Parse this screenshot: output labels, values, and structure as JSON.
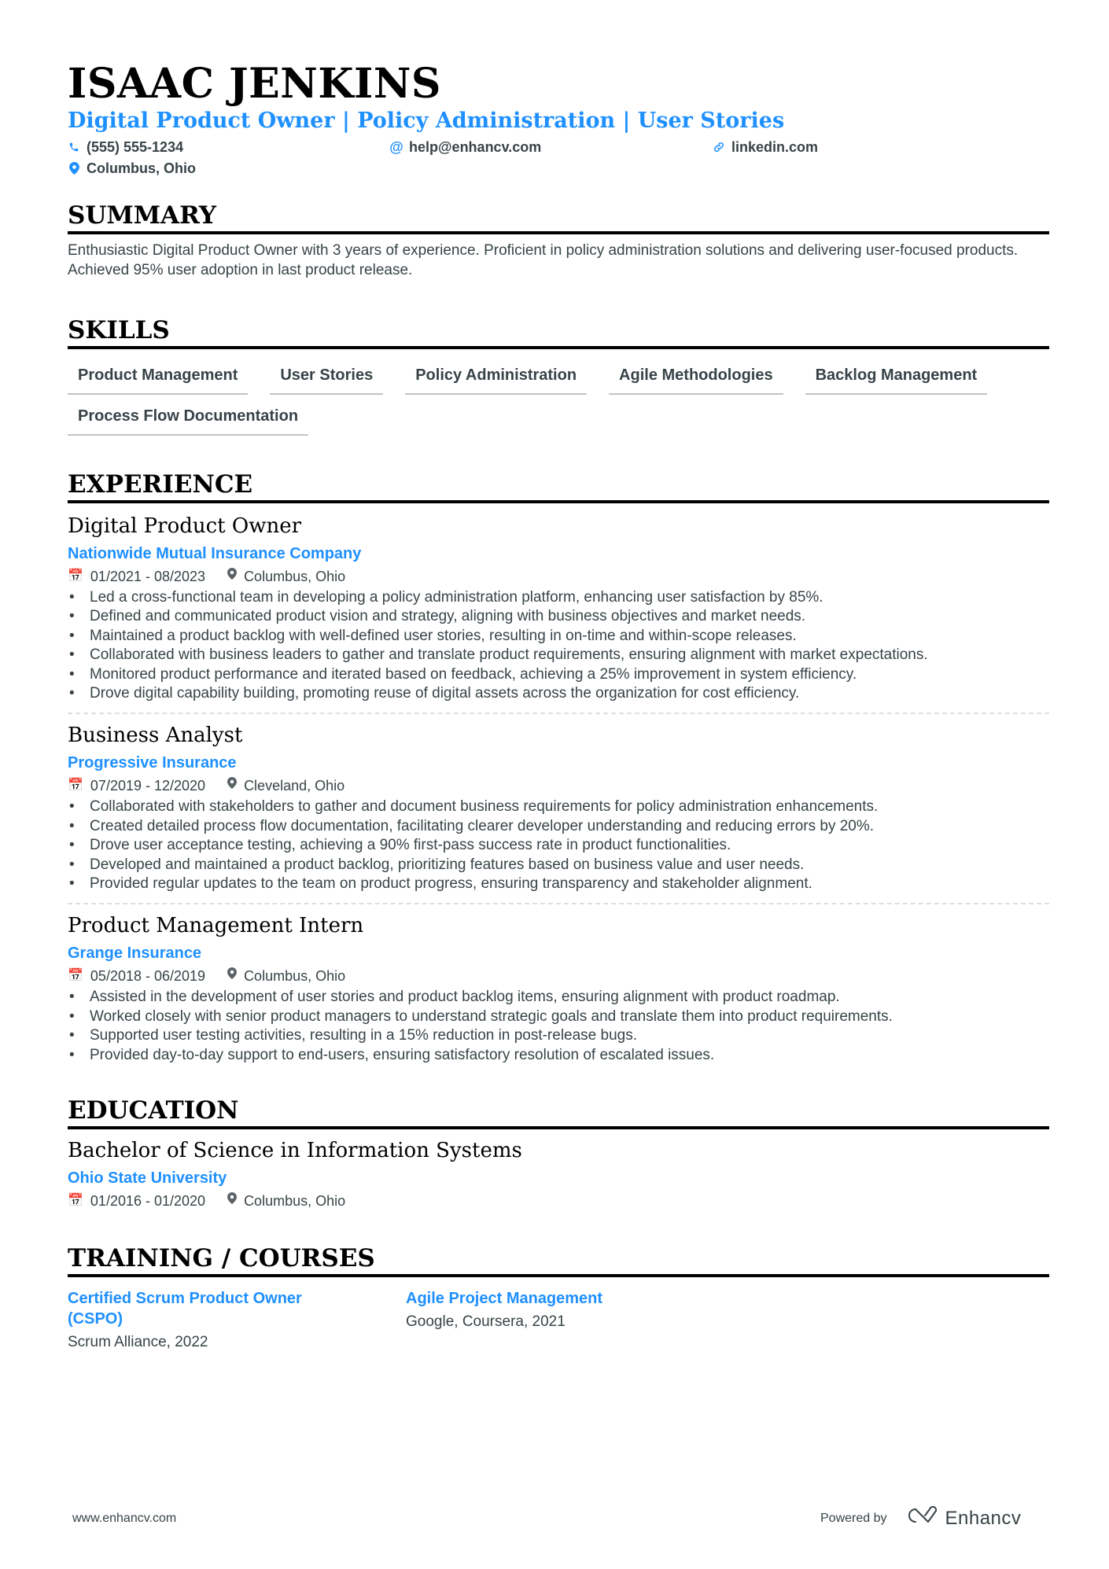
{
  "header": {
    "name": "ISAAC JENKINS",
    "headline": "Digital Product Owner | Policy Administration | User Stories",
    "contacts": {
      "phone": {
        "icon": "phone-icon",
        "value": "(555) 555-1234"
      },
      "email": {
        "icon": "at-icon",
        "value": "help@enhancv.com"
      },
      "website": {
        "icon": "link-icon",
        "value": "linkedin.com"
      },
      "location": {
        "icon": "location-pin-icon",
        "value": "Columbus, Ohio"
      }
    }
  },
  "summary": {
    "title": "SUMMARY",
    "text": "Enthusiastic Digital Product Owner with 3 years of experience. Proficient in policy administration solutions and delivering user-focused products. Achieved 95% user adoption in last product release."
  },
  "skills": {
    "title": "SKILLS",
    "items": [
      "Product Management",
      "User Stories",
      "Policy Administration",
      "Agile Methodologies",
      "Backlog Management",
      "Process Flow Documentation"
    ]
  },
  "experience": {
    "title": "EXPERIENCE",
    "jobs": [
      {
        "title": "Digital Product Owner",
        "company": "Nationwide Mutual Insurance Company",
        "dates": "01/2021 - 08/2023",
        "location": "Columbus, Ohio",
        "bullets": [
          "Led a cross-functional team in developing a policy administration platform, enhancing user satisfaction by 85%.",
          "Defined and communicated product vision and strategy, aligning with business objectives and market needs.",
          "Maintained a product backlog with well-defined user stories, resulting in on-time and within-scope releases.",
          "Collaborated with business leaders to gather and translate product requirements, ensuring alignment with market expectations.",
          "Monitored product performance and iterated based on feedback, achieving a 25% improvement in system efficiency.",
          "Drove digital capability building, promoting reuse of digital assets across the organization for cost efficiency."
        ]
      },
      {
        "title": "Business Analyst",
        "company": "Progressive Insurance",
        "dates": "07/2019 - 12/2020",
        "location": "Cleveland, Ohio",
        "bullets": [
          "Collaborated with stakeholders to gather and document business requirements for policy administration enhancements.",
          "Created detailed process flow documentation, facilitating clearer developer understanding and reducing errors by 20%.",
          "Drove user acceptance testing, achieving a 90% first-pass success rate in product functionalities.",
          "Developed and maintained a product backlog, prioritizing features based on business value and user needs.",
          "Provided regular updates to the team on product progress, ensuring transparency and stakeholder alignment."
        ]
      },
      {
        "title": "Product Management Intern",
        "company": "Grange Insurance",
        "dates": "05/2018 - 06/2019",
        "location": "Columbus, Ohio",
        "bullets": [
          "Assisted in the development of user stories and product backlog items, ensuring alignment with product roadmap.",
          "Worked closely with senior product managers to understand strategic goals and translate them into product requirements.",
          "Supported user testing activities, resulting in a 15% reduction in post-release bugs.",
          "Provided day-to-day support to end-users, ensuring satisfactory resolution of escalated issues."
        ]
      }
    ]
  },
  "education": {
    "title": "EDUCATION",
    "degree": "Bachelor of Science in Information Systems",
    "school": "Ohio State University",
    "dates": "01/2016 - 01/2020",
    "location": "Columbus, Ohio"
  },
  "training": {
    "title": "TRAINING / COURSES",
    "items": [
      {
        "title": "Certified Scrum Product Owner (CSPO)",
        "subtitle": "Scrum Alliance, 2022"
      },
      {
        "title": "Agile Project Management",
        "subtitle": "Google, Coursera, 2021"
      }
    ]
  },
  "footer": {
    "website": "www.enhancv.com",
    "powered_by": "Powered by",
    "brand": "Enhancv"
  },
  "colors": {
    "accent": "#1e90ff",
    "text": "#384347",
    "heading": "#000000"
  }
}
